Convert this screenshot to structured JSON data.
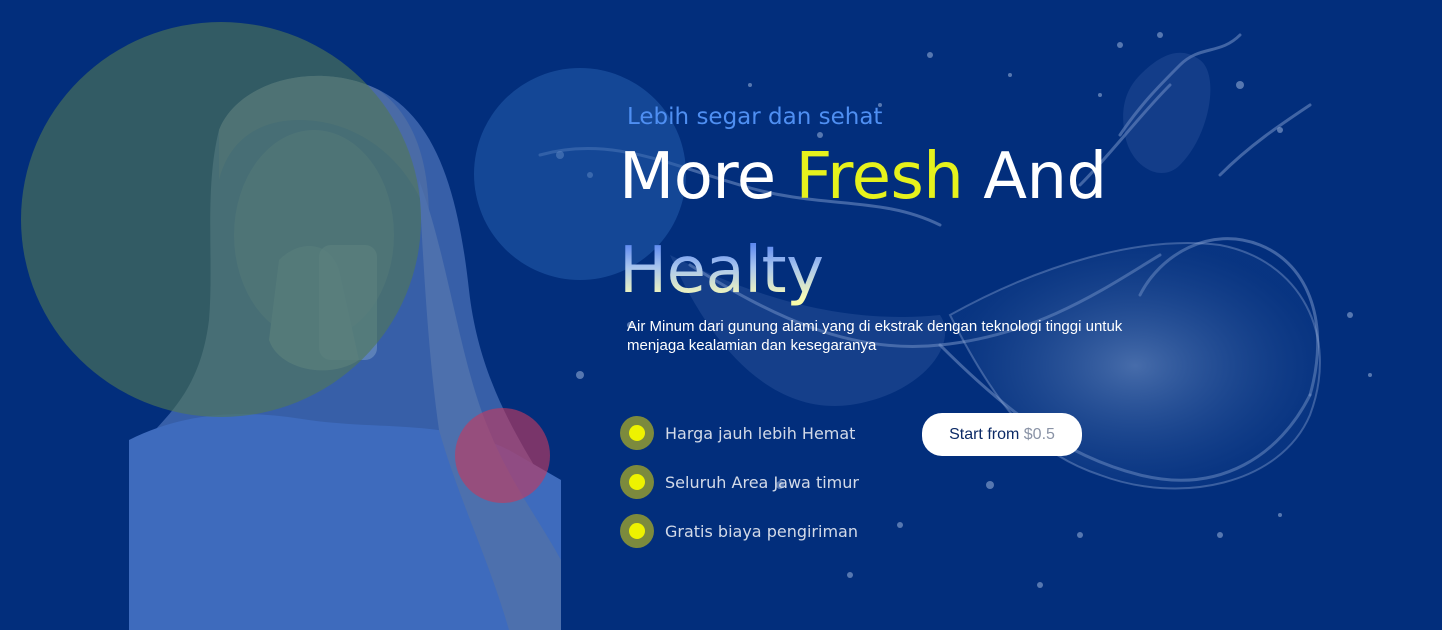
{
  "hero": {
    "subtitle": "Lebih segar dan sehat",
    "headline": {
      "part1": "More ",
      "accent": "Fresh",
      "part2": " And",
      "line2": "Healty"
    },
    "description": "Air Minum dari gunung alami yang di ekstrak dengan teknologi tinggi untuk menjaga kealamian dan kesegaranya",
    "features": [
      {
        "label": "Harga jauh lebih Hemat",
        "icon": "bullet-dot-icon"
      },
      {
        "label": "Seluruh Area Jawa timur",
        "icon": "bullet-dot-icon"
      },
      {
        "label": "Gratis biaya pengiriman",
        "icon": "bullet-dot-icon"
      }
    ],
    "cta": {
      "label": "Start from",
      "price": "$0.5"
    }
  },
  "colors": {
    "background": "#022e7c",
    "accent_yellow": "#e6f21c",
    "subtitle_blue": "#4f8ff2",
    "bullet_outer": "#7c8a3d",
    "bullet_inner": "#eef200",
    "decor_green": "#50785a",
    "decor_blue": "#245cac",
    "decor_red": "#c43a5f"
  },
  "images": {
    "photo": "woman-drinking-water-photo",
    "splash": "water-splash-graphic"
  }
}
